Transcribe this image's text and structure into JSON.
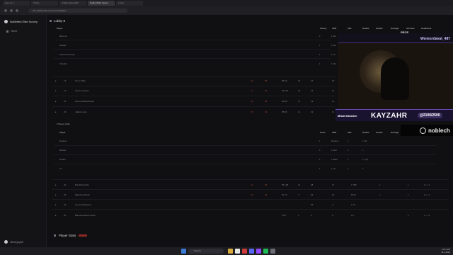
{
  "browser": {
    "tabs": [
      "Gg ▸ vh ▸",
      "Thribe",
      "vh@[redacted]/3D",
      "Nabled Elite Series",
      "Lobby"
    ],
    "url": "vhb-nabled.elite-survey.com/lobby/v"
  },
  "sidebar": {
    "brand": "NoBelted Elite Survey",
    "items": [
      {
        "label": "Home"
      }
    ],
    "user": "Jimboyoy6X"
  },
  "lobby": {
    "title": "Lobby 8"
  },
  "team1": {
    "columns": [
      "Player",
      "Survey",
      "ADR",
      "Kills",
      "Deaths",
      "Assists",
      "Damage",
      "Survives",
      "Headshots"
    ],
    "rows": [
      {
        "name": "Blenzza",
        "a": "1",
        "b": "1 Rio",
        "c": "1",
        "d": "11",
        "e": "1"
      },
      {
        "name": "Nabilla",
        "a": "1",
        "b": "1 Rio",
        "c": "1",
        "d": "1 (1)",
        "e": "1"
      },
      {
        "name": "SandsXCrossley",
        "a": "1",
        "b": "1 10",
        "c": "1",
        "d": "1",
        "e": "1"
      },
      {
        "name": "Shurikis",
        "a": "1",
        "b": "1 Rio",
        "c": "1",
        "d": "1",
        "e": "1"
      }
    ]
  },
  "stats1": [
    {
      "n": "13",
      "name": "Novu Skills",
      "p": "19",
      "q": "35",
      "r": "58.40",
      "s": "13",
      "t": "15",
      "u": "18"
    },
    {
      "n": "14",
      "name": "Steven Aerator",
      "p": "11",
      "q": "13",
      "r": "54.140",
      "s": "14",
      "t": "16",
      "u": "13"
    },
    {
      "n": "15",
      "name": "Peace Shadowhead",
      "p": "13",
      "q": "18",
      "r": "61.08",
      "s": "17",
      "t": "19",
      "u": "12"
    },
    {
      "n": "16",
      "name": "Jakkal Lotus",
      "p": "15",
      "q": "13",
      "r": "58.06",
      "s": "11",
      "t": "19",
      "u": "11"
    }
  ],
  "team2": {
    "label": "2 Player Units",
    "columns": [
      "Player",
      "Score",
      "ADR",
      "Kills",
      "Deaths",
      "Assists",
      "Damage",
      "Survives",
      "Headshots"
    ],
    "rows": [
      {
        "name": "Deekus",
        "a": "1",
        "b": "Deekus",
        "c": "1",
        "d": "1 Rio"
      },
      {
        "name": "Bubble",
        "a": "1",
        "b": "1 Ron",
        "c": "1",
        "d": "1"
      },
      {
        "name": "Deeku",
        "a": "1",
        "b": "1 ADR",
        "c": "1",
        "d": "1 (+9)"
      },
      {
        "name": "07",
        "a": "1",
        "b": "1 (1)",
        "c": "1",
        "d": "1"
      }
    ]
  },
  "stats2": [
    {
      "n": "22",
      "name": "Bund14Sorghs",
      "p": "14",
      "q": "45",
      "r": "55.138",
      "s": "11",
      "t": "38",
      "u": "71",
      "v": "1,788",
      "w": "1",
      "x": "1",
      "y": "0, 1, 1"
    },
    {
      "n": "23",
      "name": "Pjahd.Coalcraft",
      "p": "12",
      "q": "14",
      "r": "51.73",
      "s": "7",
      "t": "29",
      "u": "13",
      "v": "5513",
      "w": "1",
      "x": "1",
      "y": "0, 2, 1"
    },
    {
      "n": "24",
      "name": "Issoomsrispresso",
      "p": "",
      "q": "",
      "r": "",
      "s": "",
      "t": "29",
      "u": "4",
      "v": "1.74",
      "w": "",
      "x": "",
      "y": ""
    },
    {
      "n": "25",
      "name": "Biasomisaanaf Studio",
      "p": "",
      "q": "",
      "r": "3.50",
      "s": "1",
      "t": "2",
      "u": "2",
      "v": "1 k",
      "w": "",
      "x": "1",
      "y": "1, 1, 2"
    }
  ],
  "player_stats": {
    "title": "Player Stats"
  },
  "webcam": {
    "title": "Wenesrdavat_487",
    "rec": "RECE",
    "handle": "Mistereliaslive",
    "name": "KAYZAHR",
    "goal": "@2106/2500",
    "sponsor": "noblech"
  },
  "taskbar": {
    "search": "Search",
    "clock_time": "10:41 PM",
    "clock_date": "12-1-2024"
  }
}
